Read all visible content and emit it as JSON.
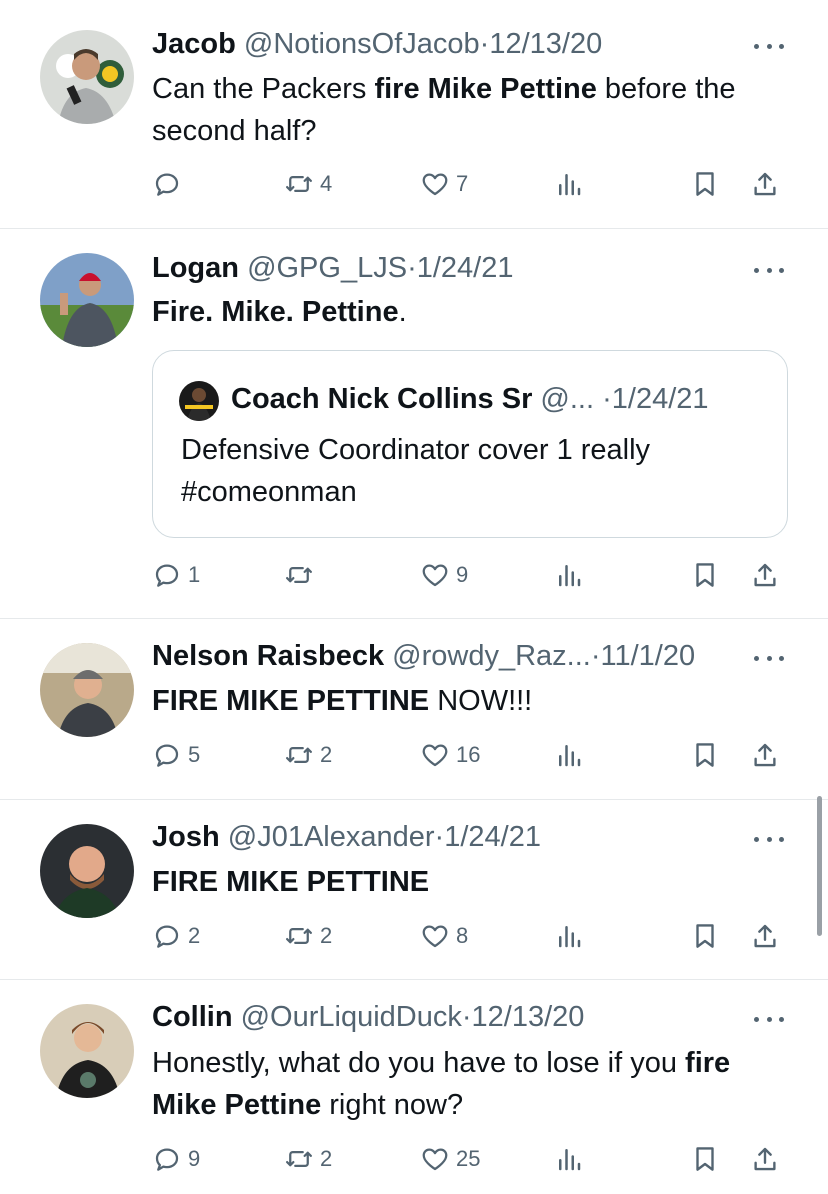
{
  "tweets": [
    {
      "name": "Jacob",
      "handle": "@NotionsOfJacob",
      "sep": "·",
      "date": "12/13/20",
      "text_parts": [
        {
          "t": "Can the Packers ",
          "bold": false
        },
        {
          "t": "fire Mike Pettine",
          "bold": true
        },
        {
          "t": " before the second half?",
          "bold": false
        }
      ],
      "replies": "",
      "retweets": "4",
      "likes": "7"
    },
    {
      "name": "Logan",
      "handle": "@GPG_LJS",
      "sep": "·",
      "date": "1/24/21",
      "text_parts": [
        {
          "t": "Fire. Mike. Pettine",
          "bold": true
        },
        {
          "t": ".",
          "bold": false
        }
      ],
      "quote": {
        "name": "Coach Nick Collins Sr",
        "handle": "@...",
        "sep": "·",
        "date": "1/24/21",
        "text": "Defensive Coordinator cover 1 really #comeonman"
      },
      "replies": "1",
      "retweets": "",
      "likes": "9"
    },
    {
      "name": "Nelson Raisbeck",
      "handle": "@rowdy_Raz...",
      "sep": "·",
      "date": "11/1/20",
      "text_parts": [
        {
          "t": "FIRE MIKE PETTINE",
          "bold": true
        },
        {
          "t": " NOW!!!",
          "bold": false
        }
      ],
      "replies": "5",
      "retweets": "2",
      "likes": "16"
    },
    {
      "name": "Josh",
      "handle": "@J01Alexander",
      "sep": "·",
      "date": "1/24/21",
      "text_parts": [
        {
          "t": "FIRE MIKE PETTINE",
          "bold": true
        }
      ],
      "replies": "2",
      "retweets": "2",
      "likes": "8"
    },
    {
      "name": "Collin",
      "handle": "@OurLiquidDuck",
      "sep": "·",
      "date": "12/13/20",
      "text_parts": [
        {
          "t": "Honestly, what do you have to lose if you ",
          "bold": false
        },
        {
          "t": "fire Mike Pettine",
          "bold": true
        },
        {
          "t": " right now?",
          "bold": false
        }
      ],
      "replies": "9",
      "retweets": "2",
      "likes": "25"
    }
  ],
  "icons": {
    "reply": "reply-icon",
    "retweet": "retweet-icon",
    "like": "heart-icon",
    "views": "views-icon",
    "bookmark": "bookmark-icon",
    "share": "share-icon",
    "more": "more-icon"
  },
  "colors": {
    "text": "#0f1419",
    "muted": "#536471",
    "divider": "#e6e9eb",
    "quote_border": "#cfd9de"
  }
}
